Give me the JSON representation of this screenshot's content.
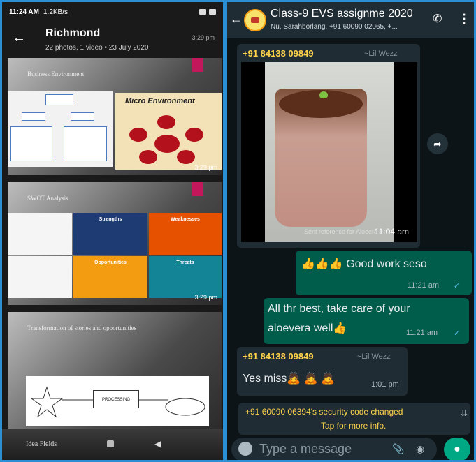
{
  "gallery": {
    "status_time": "11:24 AM",
    "status_speed": "1.2KB/s",
    "back_icon": "back-arrow-icon",
    "title": "Richmond",
    "subtitle": "22 photos, 1 video • 23 July 2020",
    "header_time": "3:29 pm",
    "cards": [
      {
        "title": "Business Environment",
        "inset_title": "Micro Environment",
        "time": "3:29 pm"
      },
      {
        "title": "SWOT Analysis",
        "time": "3:29 pm",
        "quadrants": [
          {
            "heading": "Strengths",
            "color": "#1f3b73"
          },
          {
            "heading": "Weaknesses",
            "color": "#e65100"
          },
          {
            "heading": "Opportunities",
            "color": "#f39c12"
          },
          {
            "heading": "Threats",
            "color": "#138496"
          }
        ]
      },
      {
        "title": "Transformation of stories and opportunities",
        "process_label": "PROCESSING"
      }
    ],
    "bottom_label": "Idea Fields"
  },
  "chat": {
    "back_icon": "back-arrow-icon",
    "title": "Class-9 EVS assignme 2020",
    "subtitle": "Nu, Sarahborlang, +91 60090 02065, +...",
    "call_icon": "add-call-icon",
    "menu_icon": "more-vert-icon",
    "messages": [
      {
        "sender": "+91 84138 09849",
        "alias": "~Lil Wezz",
        "type": "image",
        "caption": "Sent reference for Aloeera",
        "time": "11:04 am"
      },
      {
        "type": "outgoing",
        "text": "👍👍👍 Good work seso",
        "time": "11:21 am"
      },
      {
        "type": "outgoing",
        "text_line1": "All thr best, take care of your",
        "text_line2": "aloevera well👍",
        "time": "11:21 am"
      },
      {
        "sender": "+91 84138 09849",
        "alias": "~Lil Wezz",
        "type": "incoming",
        "text": "Yes miss🙇 🙇 🙇",
        "time": "1:01 pm"
      }
    ],
    "system_line1": "+91 60090 06394's security code changed",
    "system_line2": "Tap for more info.",
    "compose_placeholder": "Type a message",
    "accent": "#00a884"
  }
}
